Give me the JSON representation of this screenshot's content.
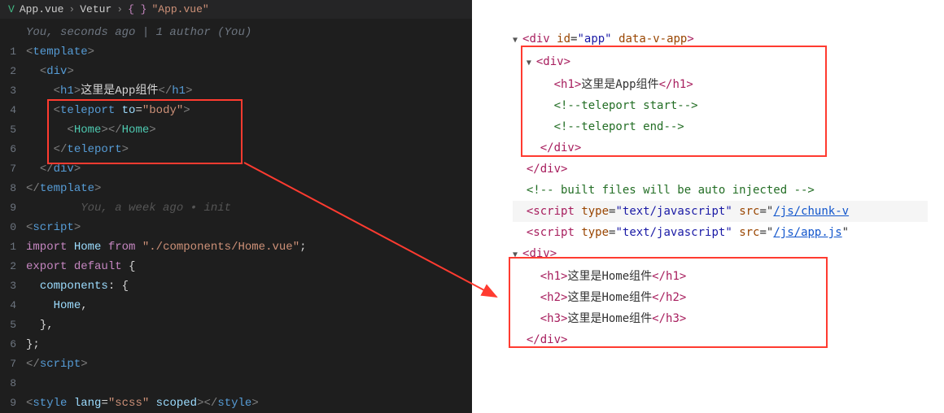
{
  "breadcrumbs": {
    "file": "App.vue",
    "mode": "Vetur",
    "string": "\"App.vue\""
  },
  "authors_line": "You, seconds ago | 1 author (You)",
  "ghost_hint": "You, a week ago • init",
  "code": {
    "template_open": "template",
    "div": "div",
    "h1": "h1",
    "h1_text": "这里是App组件",
    "teleport": "teleport",
    "to_attr": "to",
    "to_val": "\"body\"",
    "home": "Home",
    "script": "script",
    "import": "import",
    "from": "from",
    "path": "\"./components/Home.vue\"",
    "export": "export",
    "default": "default",
    "components": "components",
    "comma_home": "Home",
    "style": "style",
    "lang": "lang",
    "scss": "\"scss\"",
    "scoped": "scoped"
  },
  "line_numbers": [
    "",
    "1",
    "2",
    "3",
    "4",
    "5",
    "6",
    "7",
    "8",
    "9",
    "0",
    "1",
    "2",
    "3",
    "4",
    "5",
    "6",
    "7",
    "8",
    "9"
  ],
  "devtools": {
    "div_open": "div",
    "id_attr": "id",
    "id_val": "\"app\"",
    "data_v": "data-v-app",
    "inner_div": "div",
    "h1": "h1",
    "h1_text": "这里是App组件",
    "tp_start": "<!--teleport start-->",
    "tp_end": "<!--teleport end-->",
    "built_comment": "<!-- built files will be auto injected -->",
    "script": "script",
    "type_attr": "type",
    "type_val": "\"text/javascript\"",
    "src_attr": "src",
    "src1": "/js/chunk-v",
    "src2": "/js/app.js",
    "h1b": "h1",
    "h2b": "h2",
    "h3b": "h3",
    "home_text1": "这里是Home组件",
    "home_text2": "这里是Home组件",
    "home_text3": "这里是Home组件"
  }
}
